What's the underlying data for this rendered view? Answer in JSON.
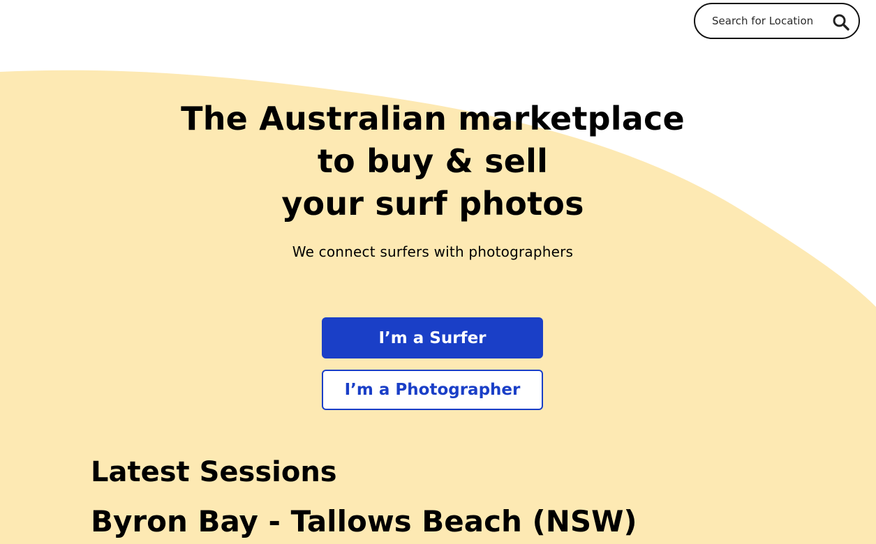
{
  "header": {
    "search": {
      "placeholder": "Search for Location"
    }
  },
  "hero": {
    "title_lines": [
      "The Australian marketplace",
      "to buy & sell",
      "your surf photos"
    ],
    "subtitle": "We connect surfers with photographers",
    "buttons": {
      "surfer": "I’m a Surfer",
      "photographer": "I’m a Photographer"
    }
  },
  "sessions": {
    "heading": "Latest Sessions",
    "items": [
      {
        "location": "Byron Bay - Tallows Beach (NSW)"
      }
    ]
  },
  "colors": {
    "accent": "#1a3fc7",
    "background_wave": "#fde9b3",
    "text": "#000000"
  },
  "icons": {
    "search": "search-icon"
  }
}
